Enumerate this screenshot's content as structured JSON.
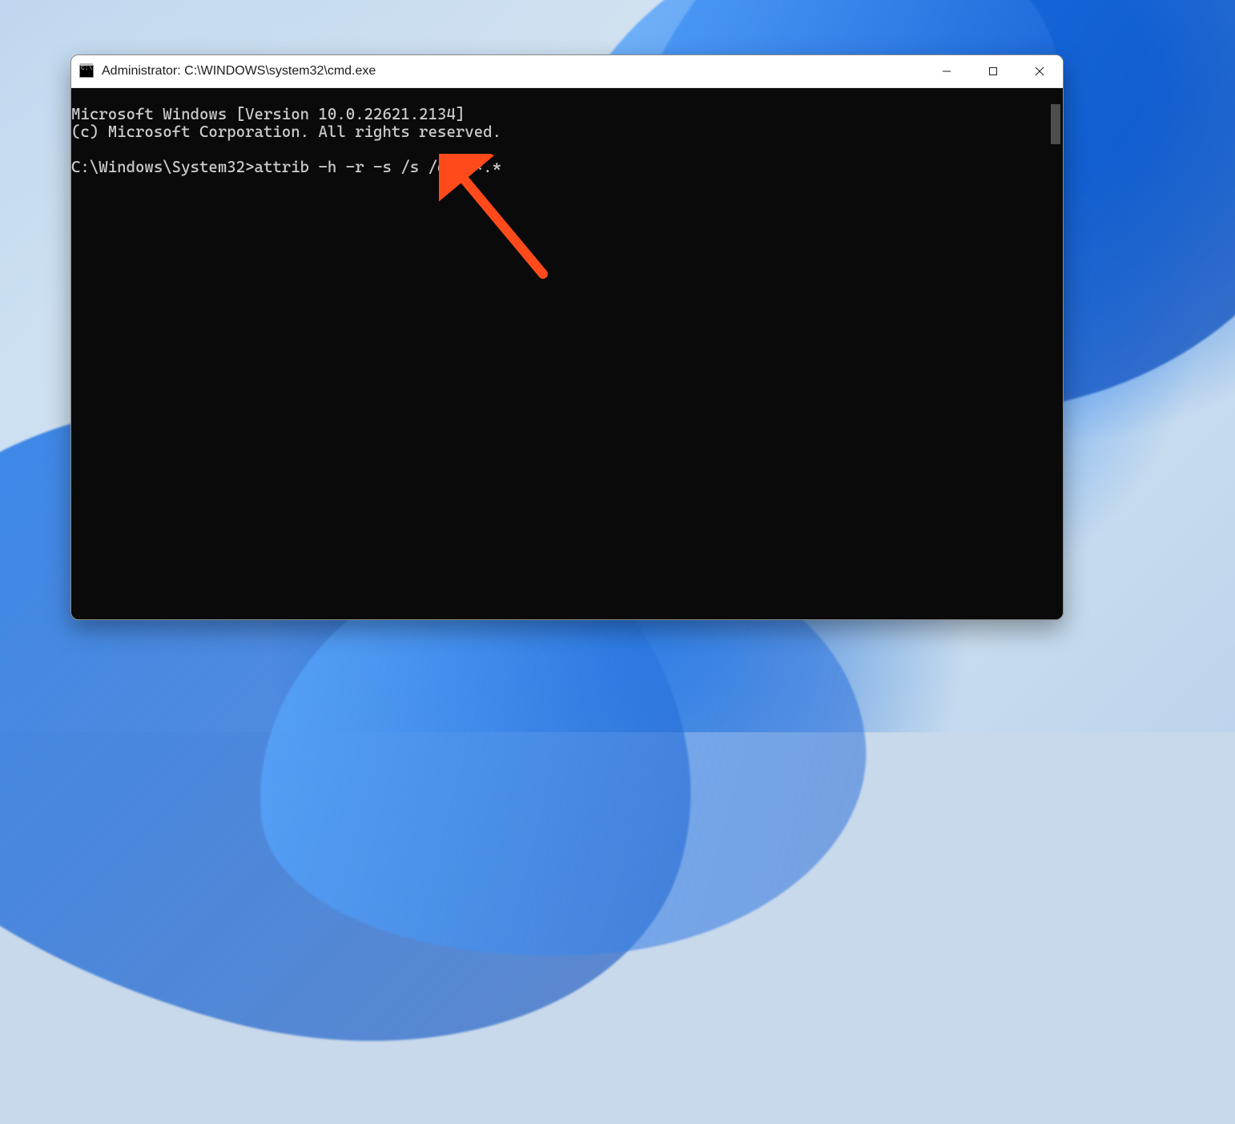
{
  "window": {
    "title": "Administrator: C:\\WINDOWS\\system32\\cmd.exe"
  },
  "terminal": {
    "lines": [
      "Microsoft Windows [Version 10.0.22621.2134]",
      "(c) Microsoft Corporation. All rights reserved.",
      "",
      "C:\\Windows\\System32>attrib -h -r -s /s /d D:*.*"
    ],
    "prompt": "C:\\Windows\\System32>",
    "command": "attrib -h -r -s /s /d D:*.*"
  },
  "annotation": {
    "type": "arrow",
    "color": "#ff4a1c",
    "points_to": "typed command"
  }
}
